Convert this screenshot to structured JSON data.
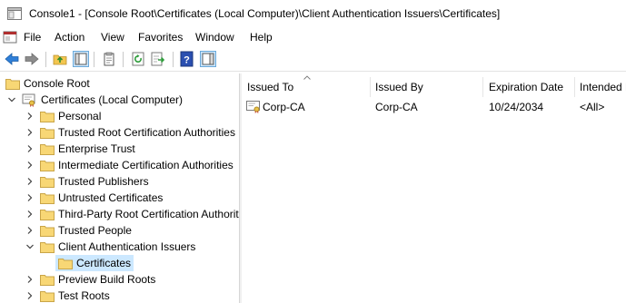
{
  "window": {
    "title": "Console1 - [Console Root\\Certificates (Local Computer)\\Client Authentication Issuers\\Certificates]"
  },
  "menu": [
    "File",
    "Action",
    "View",
    "Favorites",
    "Window",
    "Help"
  ],
  "toolbar": {
    "buttons": [
      "back-icon",
      "forward-icon",
      "up-folder-icon",
      "show-hide-tree-icon",
      "properties-icon",
      "refresh-icon",
      "export-list-icon",
      "help-icon",
      "show-hide-action-pane-icon"
    ]
  },
  "tree": {
    "root": "Console Root",
    "store": "Certificates (Local Computer)",
    "items": [
      "Personal",
      "Trusted Root Certification Authorities",
      "Enterprise Trust",
      "Intermediate Certification Authorities",
      "Trusted Publishers",
      "Untrusted Certificates",
      "Third-Party Root Certification Authorities",
      "Trusted People",
      "Client Authentication Issuers",
      "Preview Build Roots",
      "Test Roots"
    ],
    "child": "Certificates"
  },
  "list": {
    "columns": [
      "Issued To",
      "Issued By",
      "Expiration Date",
      "Intended Purposes"
    ],
    "rows": [
      {
        "issued_to": "Corp-CA",
        "issued_by": "Corp-CA",
        "expiration": "10/24/2034",
        "purposes": "<All>"
      }
    ]
  },
  "colors": {
    "selection": "#cce8ff",
    "folder": "#f8d775",
    "accent_blue": "#1e7bd2"
  }
}
